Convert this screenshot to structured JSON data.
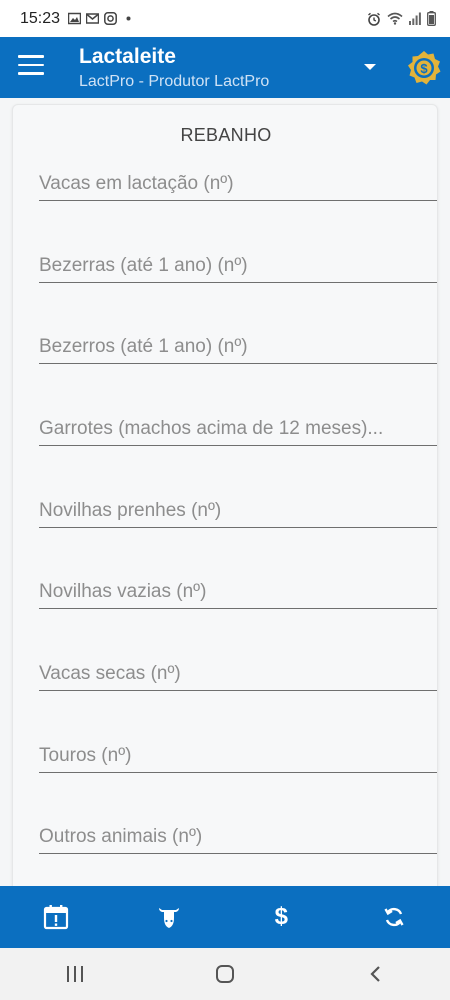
{
  "status_bar": {
    "time": "15:23",
    "left_icons": [
      "gallery-icon",
      "gmail-icon",
      "instagram-icon",
      "dot-icon"
    ],
    "right_icons": [
      "alarm-icon",
      "wifi-icon",
      "signal-icon",
      "battery-icon"
    ]
  },
  "app_bar": {
    "title": "Lactaleite",
    "subtitle": "LactPro - Produtor LactPro",
    "menu_icon": "hamburger-menu-icon",
    "dropdown_icon": "caret-down-icon",
    "coin_icon": "dollar-badge-icon",
    "color": "#0b6fc0",
    "coin_color": "#e2b33a"
  },
  "form": {
    "section_title": "REBANHO",
    "fields": [
      {
        "label": "Vacas em lactação (nº)"
      },
      {
        "label": "Bezerras (até 1 ano) (nº)"
      },
      {
        "label": "Bezerros (até 1 ano) (nº)"
      },
      {
        "label": "Garrotes (machos acima de 12 meses)..."
      },
      {
        "label": "Novilhas prenhes (nº)"
      },
      {
        "label": "Novilhas vazias (nº)"
      },
      {
        "label": "Vacas secas (nº)"
      },
      {
        "label": "Touros (nº)"
      },
      {
        "label": "Outros animais (nº)"
      }
    ]
  },
  "bottom_nav": {
    "items": [
      {
        "icon": "calendar-alert-icon"
      },
      {
        "icon": "cow-head-icon"
      },
      {
        "icon": "dollar-icon",
        "glyph": "$"
      },
      {
        "icon": "sync-icon"
      }
    ]
  },
  "system_nav": {
    "items": [
      {
        "icon": "recent-apps-icon"
      },
      {
        "icon": "home-icon"
      },
      {
        "icon": "back-icon"
      }
    ]
  }
}
